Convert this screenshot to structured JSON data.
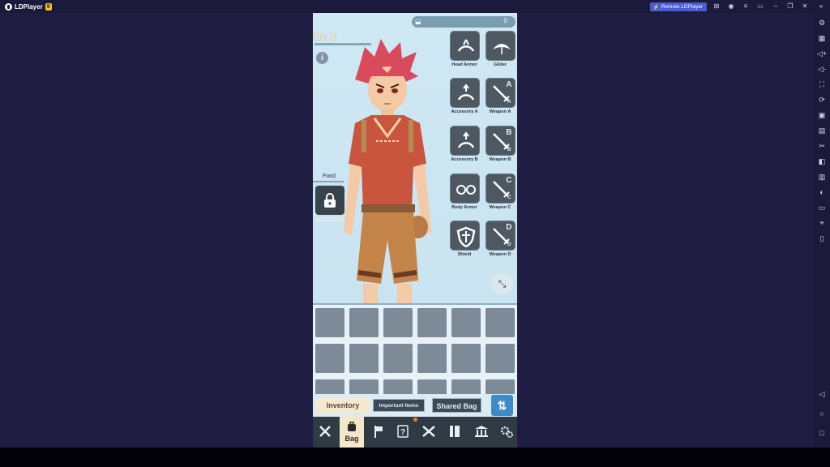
{
  "emulator": {
    "app_name": "LDPlayer",
    "version_badge": "9",
    "remote_button_label": "Remote LDPlayer",
    "titlebar_icons": [
      "gamepad-icon",
      "user-icon",
      "menu-icon",
      "window-icon",
      "minimize-icon",
      "restore-icon",
      "close-icon",
      "collapse-icon"
    ],
    "sidebar_icons": [
      "settings-icon",
      "keyboard-icon",
      "volume-up-icon",
      "volume-down-icon",
      "screenshot-icon",
      "sync-icon",
      "apk-icon",
      "multi-instance-icon",
      "scissors-icon",
      "record-icon",
      "operation-icon",
      "macro-icon",
      "folder-icon",
      "location-icon",
      "shake-icon",
      "back-icon",
      "home-icon",
      "recent-icon"
    ]
  },
  "game": {
    "currency_value": "0",
    "level_label": "Lv. 1",
    "info_label": "i",
    "food_label": "Food",
    "equipment_slots": [
      {
        "label": "Head Armor",
        "icon": "helmet-icon",
        "letter": ""
      },
      {
        "label": "Glider",
        "icon": "glider-icon",
        "letter": ""
      },
      {
        "label": "Accessory A",
        "icon": "accessory-icon",
        "letter": ""
      },
      {
        "label": "Weapon A",
        "icon": "sword-icon",
        "letter": "A"
      },
      {
        "label": "Accessory B",
        "icon": "accessory-icon",
        "letter": ""
      },
      {
        "label": "Weapon B",
        "icon": "sword-icon",
        "letter": "B"
      },
      {
        "label": "Body Armor",
        "icon": "glasses-icon",
        "letter": ""
      },
      {
        "label": "Weapon C",
        "icon": "sword-icon",
        "letter": "C"
      },
      {
        "label": "Shield",
        "icon": "shield-icon",
        "letter": ""
      },
      {
        "label": "Weapon D",
        "icon": "sword-icon",
        "letter": "D"
      }
    ],
    "tabs": {
      "inventory": "Inventory",
      "important_items": "Important Items",
      "shared_bag": "Shared Bag"
    },
    "nav": {
      "bag_label": "Bag",
      "items": [
        "close-icon",
        "bag-icon",
        "flag-icon",
        "quest-icon",
        "crossed-swords-icon",
        "book-icon",
        "bank-icon",
        "settings-icon"
      ]
    }
  },
  "colors": {
    "emulator_bg": "#1f1d42",
    "accent_blue": "#4a5bd6",
    "slot_bg": "#4d5862",
    "active_tab": "#f6e8cf"
  }
}
